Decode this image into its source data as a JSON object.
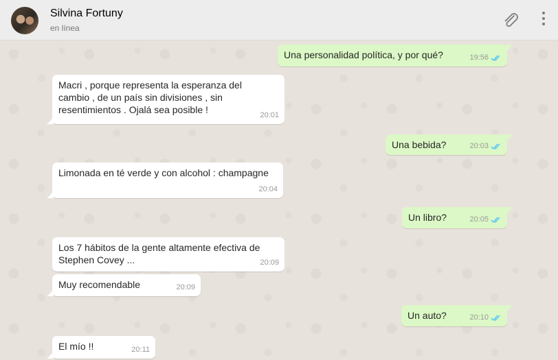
{
  "header": {
    "contact_name": "Silvina Fortuny",
    "status": "en línea",
    "attach_icon": "paperclip-icon",
    "menu_icon": "kebab-menu-icon"
  },
  "colors": {
    "incoming_bubble": "#ffffff",
    "outgoing_bubble": "#dcf8c6",
    "read_ticks": "#4fc3f7",
    "chat_background": "#e5ddd5"
  },
  "messages": [
    {
      "direction": "out",
      "text": "Una personalidad política, y por qué?",
      "time": "19:56",
      "status": "read"
    },
    {
      "direction": "in",
      "text": "Macri , porque representa la esperanza del\ncambio , de un país sin divisiones , sin\nresentimientos . Ojalá sea posible !",
      "time": "20:01"
    },
    {
      "direction": "out",
      "text": "Una bebida?",
      "time": "20:03",
      "status": "read"
    },
    {
      "direction": "in",
      "text": "Limonada en té verde y con alcohol : champagne",
      "time": "20:04"
    },
    {
      "direction": "out",
      "text": "Un libro?",
      "time": "20:05",
      "status": "read"
    },
    {
      "direction": "in",
      "text": "Los 7 hábitos de la gente altamente efectiva de\nStephen Covey ...",
      "time": "20:09"
    },
    {
      "direction": "in",
      "text": "Muy recomendable",
      "time": "20:09"
    },
    {
      "direction": "out",
      "text": "Un auto?",
      "time": "20:10",
      "status": "read"
    },
    {
      "direction": "in",
      "text": "El mío !!",
      "time": "20:11"
    }
  ]
}
